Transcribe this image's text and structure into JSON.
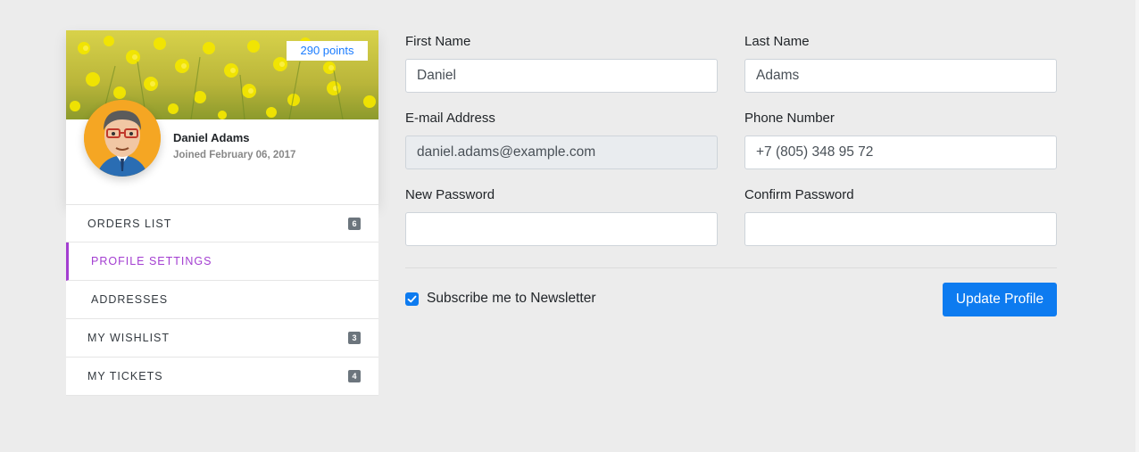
{
  "profile": {
    "points_label": "290 points",
    "name": "Daniel Adams",
    "joined": "Joined February 06, 2017"
  },
  "menu": {
    "items": [
      {
        "label": "ORDERS LIST",
        "badge": "6"
      },
      {
        "label": "PROFILE SETTINGS",
        "badge": null
      },
      {
        "label": "ADDRESSES",
        "badge": null
      },
      {
        "label": "MY WISHLIST",
        "badge": "3"
      },
      {
        "label": "MY TICKETS",
        "badge": "4"
      }
    ],
    "active_index": 1
  },
  "form": {
    "first_name": {
      "label": "First Name",
      "value": "Daniel"
    },
    "last_name": {
      "label": "Last Name",
      "value": "Adams"
    },
    "email": {
      "label": "E-mail Address",
      "value": "daniel.adams@example.com"
    },
    "phone": {
      "label": "Phone Number",
      "value": "+7 (805) 348 95 72"
    },
    "new_password": {
      "label": "New Password",
      "value": ""
    },
    "confirm_password": {
      "label": "Confirm Password",
      "value": ""
    },
    "newsletter": {
      "label": "Subscribe me to Newsletter",
      "checked": true
    },
    "submit_label": "Update Profile"
  },
  "colors": {
    "accent": "#0d7bf0",
    "active_menu": "#a33ed1",
    "points_text": "#1a7cff",
    "avatar_bg": "#f5a623"
  },
  "icons": {
    "checkbox": "checkmark-icon"
  }
}
